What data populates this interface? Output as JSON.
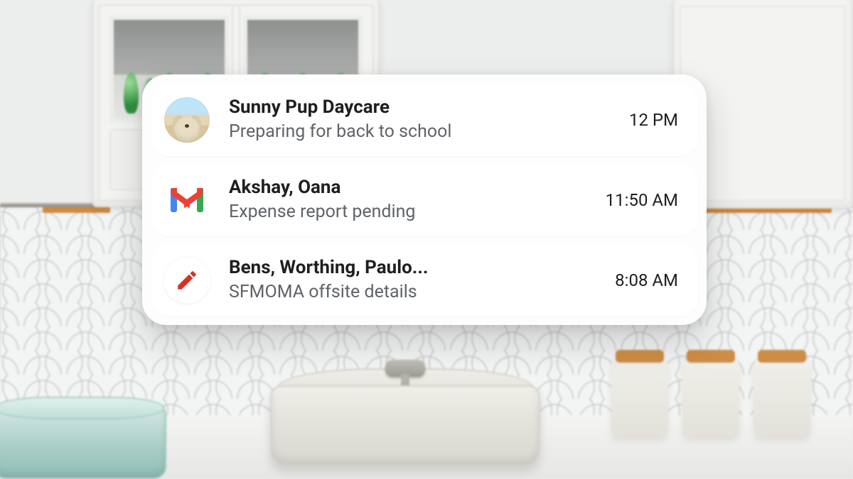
{
  "widget": {
    "emails": [
      {
        "iconKind": "avatar-dog",
        "sender": "Sunny Pup Daycare",
        "subject": "Preparing for back to school",
        "time": "12 PM"
      },
      {
        "iconKind": "gmail",
        "sender": "Akshay, Oana",
        "subject": "Expense report pending",
        "time": "11:50 AM"
      },
      {
        "iconKind": "pencil",
        "sender": "Bens, Worthing, Paulo...",
        "subject": "SFMOMA offsite details",
        "time": "8:08 AM"
      }
    ]
  },
  "colors": {
    "textPrimary": "#1f1f1f",
    "textSecondary": "#5f6368",
    "gmailRed": "#EA4335",
    "gmailBlue": "#4285F4",
    "gmailGreen": "#34A853",
    "gmailYellow": "#FBBC04",
    "draftRed": "#D93025"
  }
}
